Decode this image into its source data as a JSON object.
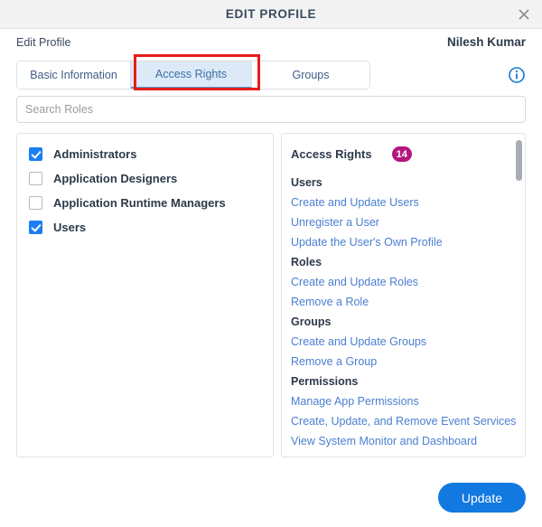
{
  "window": {
    "title": "EDIT PROFILE",
    "close_icon": "close-icon"
  },
  "header": {
    "section_label": "Edit Profile",
    "user_name": "Nilesh Kumar",
    "info_icon": "info-circle-icon"
  },
  "tabs": [
    {
      "label": "Basic Information",
      "active": false
    },
    {
      "label": "Access Rights",
      "active": true
    },
    {
      "label": "Groups",
      "active": false
    }
  ],
  "search": {
    "placeholder": "Search Roles",
    "value": ""
  },
  "roles_panel": {
    "items": [
      {
        "label": "Administrators",
        "checked": true
      },
      {
        "label": "Application Designers",
        "checked": false
      },
      {
        "label": "Application Runtime Managers",
        "checked": false
      },
      {
        "label": "Users",
        "checked": true
      }
    ]
  },
  "rights_panel": {
    "title": "Access Rights",
    "count": "14",
    "groups": [
      {
        "name": "Users",
        "items": [
          "Create and Update Users",
          "Unregister a User",
          "Update the User's Own Profile"
        ]
      },
      {
        "name": "Roles",
        "items": [
          "Create and Update Roles",
          "Remove a Role"
        ]
      },
      {
        "name": "Groups",
        "items": [
          "Create and Update Groups",
          "Remove a Group"
        ]
      },
      {
        "name": "Permissions",
        "items": [
          "Manage App Permissions",
          "Create, Update, and Remove Event Services",
          "View System Monitor and Dashboard"
        ]
      }
    ]
  },
  "footer": {
    "update_label": "Update"
  },
  "colors": {
    "accent_blue": "#1279e0",
    "link_blue": "#4a7fd1",
    "badge_magenta": "#b3167e",
    "active_tab_bg": "#dceaf7",
    "annotation_red": "#e81c1c"
  }
}
